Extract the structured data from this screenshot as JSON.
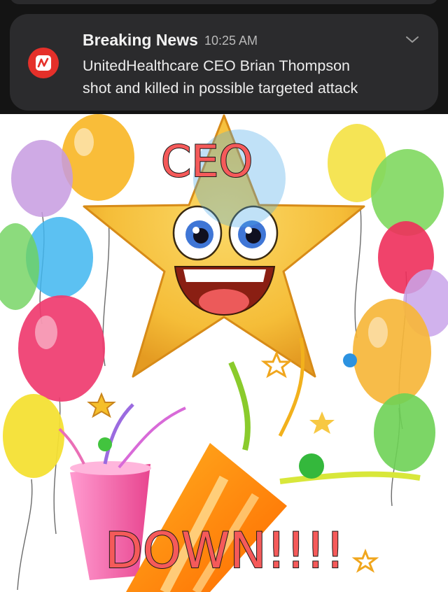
{
  "notification": {
    "app_icon": "news-app-icon",
    "title": "Breaking News",
    "time": "10:25 AM",
    "body_line1": "UnitedHealthcare CEO Brian Thompson",
    "body_line2": "shot and killed in possible targeted attack",
    "expand_icon": "chevron-down-icon"
  },
  "meme": {
    "top_text": "CEO",
    "bottom_text": "DOWN!!!!"
  },
  "colors": {
    "notification_bg": "#2b2b2d",
    "app_icon_red": "#e5302a",
    "meme_text": "#f55a5a",
    "star": "#f7c53d"
  }
}
